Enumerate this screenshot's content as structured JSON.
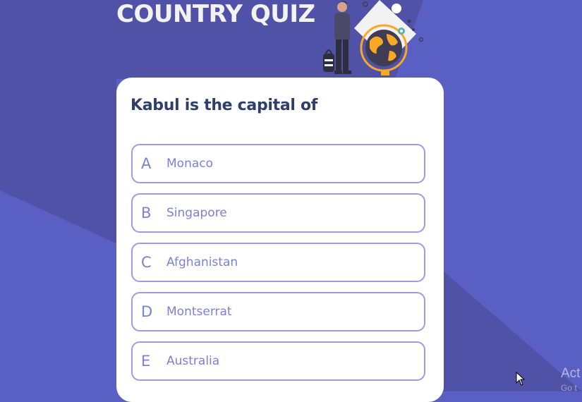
{
  "app": {
    "title": "COUNTRY QUIZ"
  },
  "quiz": {
    "question": "Kabul is the capital of",
    "options": [
      {
        "letter": "A",
        "answer": "Monaco"
      },
      {
        "letter": "B",
        "answer": "Singapore"
      },
      {
        "letter": "C",
        "answer": "Afghanistan"
      },
      {
        "letter": "D",
        "answer": "Montserrat"
      },
      {
        "letter": "E",
        "answer": "Australia"
      }
    ]
  },
  "watermark": {
    "line1": "Act",
    "line2": "Go t"
  },
  "colors": {
    "background": "#5a5fc4",
    "background_dark": "#4f52a6",
    "card": "#ffffff",
    "question_text": "#2f3f6b",
    "option_text": "#7c80d6",
    "option_border": "#9a9ddf",
    "globe_accent": "#f9a826"
  },
  "icons": {
    "illustration": "traveler-with-globe-illustration",
    "cursor": "mouse-cursor-icon"
  }
}
